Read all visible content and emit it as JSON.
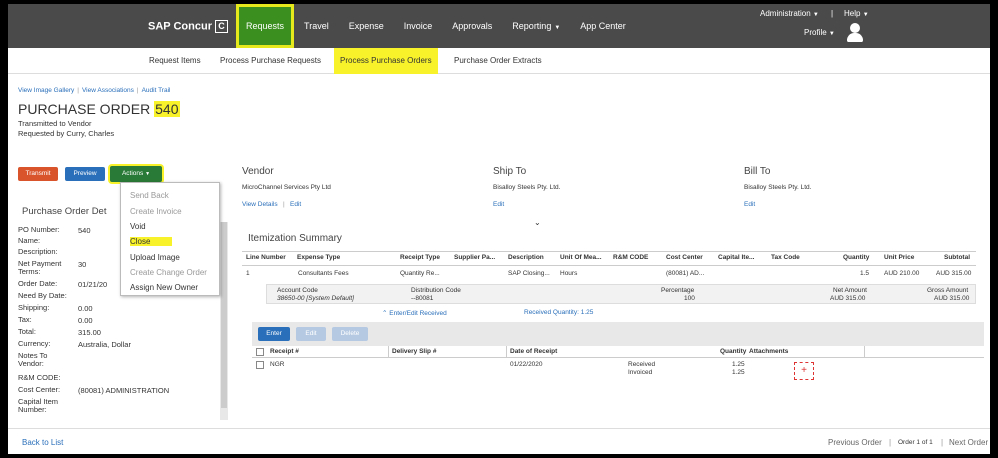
{
  "app": {
    "brand": "SAP Concur",
    "brand_icon": "C",
    "nav": [
      {
        "label": "Requests",
        "active": true
      },
      {
        "label": "Travel"
      },
      {
        "label": "Expense"
      },
      {
        "label": "Invoice"
      },
      {
        "label": "Approvals"
      },
      {
        "label": "Reporting"
      },
      {
        "label": "App Center"
      }
    ],
    "administration": "Administration",
    "help": "Help",
    "profile": "Profile",
    "accent_color": "#3a8f1e",
    "highlight_color": "#f7f22a"
  },
  "subnav": [
    "Request Items",
    "Process Purchase Requests",
    "Process Purchase Orders",
    "Purchase Order Extracts"
  ],
  "links": [
    "View Image Gallery",
    "View Associations",
    "Audit Trail"
  ],
  "po": {
    "title_prefix": "PURCHASE ORDER",
    "number": "540",
    "status": "Transmitted to Vendor",
    "requested_by": "Requested by Curry, Charles"
  },
  "buttons": {
    "transmit": "Transmit",
    "preview": "Preview",
    "actions": "Actions"
  },
  "actions_menu": [
    {
      "label": "Send Back",
      "disabled": true
    },
    {
      "label": "Create Invoice",
      "disabled": true
    },
    {
      "label": "Void",
      "disabled": false
    },
    {
      "label": "Close",
      "disabled": false,
      "highlight": true
    },
    {
      "label": "Upload Image",
      "disabled": false
    },
    {
      "label": "Create Change Order",
      "disabled": true
    },
    {
      "label": "Assign New Owner",
      "disabled": false
    }
  ],
  "details_heading": "Purchase Order Det",
  "details": [
    {
      "label": "PO Number:",
      "value": "540"
    },
    {
      "label": "Name:",
      "value": ""
    },
    {
      "label": "Description:",
      "value": ""
    },
    {
      "label": "Net Payment Terms:",
      "value": "30"
    },
    {
      "label": "Order Date:",
      "value": "01/21/20"
    },
    {
      "label": "Need By Date:",
      "value": ""
    },
    {
      "label": "Shipping:",
      "value": "0.00"
    },
    {
      "label": "Tax:",
      "value": "0.00"
    },
    {
      "label": "Total:",
      "value": "315.00"
    },
    {
      "label": "Currency:",
      "value": "Australia, Dollar"
    },
    {
      "label": "Notes To Vendor:",
      "value": ""
    },
    {
      "label": "R&M CODE:",
      "value": ""
    },
    {
      "label": "Cost Center:",
      "value": "(80081) ADMINISTRATION"
    },
    {
      "label": "Capital Item Number:",
      "value": ""
    }
  ],
  "vendor": {
    "heading": "Vendor",
    "name": "MicroChannel Services Pty Ltd",
    "view_details": "View Details",
    "edit": "Edit"
  },
  "ship_to": {
    "heading": "Ship To",
    "name": "Bisalloy Steels Pty. Ltd.",
    "edit": "Edit"
  },
  "bill_to": {
    "heading": "Bill To",
    "name": "Bisalloy Steels Pty. Ltd.",
    "edit": "Edit"
  },
  "itemization": {
    "heading": "Itemization Summary",
    "columns": [
      "Line Number",
      "Expense Type",
      "Receipt Type",
      "Supplier Pa...",
      "Description",
      "Unit Of Mea...",
      "R&M CODE",
      "Cost Center",
      "Capital Ite...",
      "Tax Code",
      "Quantity",
      "Unit Price",
      "Subtotal"
    ],
    "row": [
      "1",
      "Consultants Fees",
      "Quantity Re...",
      "",
      "SAP Closing...",
      "Hours",
      "",
      "(80081) AD...",
      "",
      "",
      "1.5",
      "AUD 210.00",
      "AUD 315.00"
    ],
    "alloc_columns": [
      "Account Code",
      "Distribution Code",
      "Percentage",
      "Net Amount",
      "Gross Amount"
    ],
    "alloc_row": [
      "38650-00 [System Default]",
      "--80081",
      "100",
      "AUD 315.00",
      "AUD 315.00"
    ],
    "enter_edit": "Enter/Edit Received",
    "received_qty": "Received Quantity: 1.25"
  },
  "receipts": {
    "buttons": [
      "Enter",
      "Edit",
      "Delete"
    ],
    "columns": [
      "Receipt #",
      "Delivery Slip #",
      "Date of Receipt",
      "Quantity",
      "Attachments"
    ],
    "row": {
      "receipt": "NGR",
      "delivery": "",
      "date": "01/22/2020",
      "status1": "Received",
      "status2": "Invoiced",
      "qty1": "1.25",
      "qty2": "1.25"
    },
    "add_icon": "+"
  },
  "footer": {
    "back": "Back to List",
    "prev": "Previous Order",
    "order_of": "Order 1 of 1",
    "next": "Next Order"
  }
}
